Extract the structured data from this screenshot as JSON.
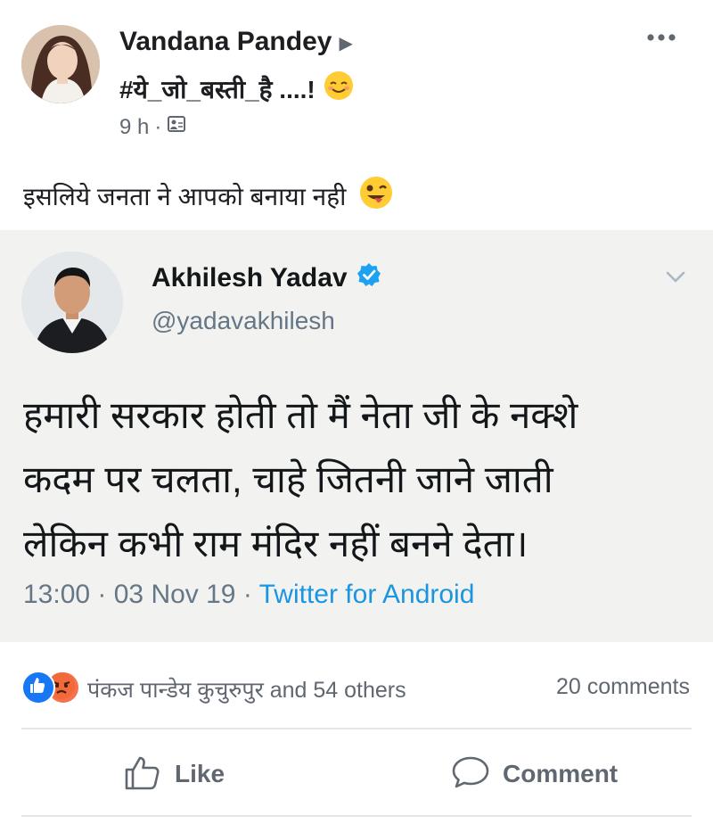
{
  "post": {
    "author": "Vandana Pandey",
    "hashtag_line": "#ये_जो_बस्ती_है ....!",
    "time": "9 h",
    "caption": "इसलिये जनता ने आपको बनाया नही",
    "icons": {
      "author_arrow": "play-arrow-icon",
      "hashtag_emoji": "smiling-emoji-icon",
      "audience": "audience-icon",
      "more": "more-dots-icon",
      "caption_emoji": "winking-tongue-emoji-icon"
    }
  },
  "shared_tweet": {
    "name": "Akhilesh Yadav",
    "handle": "@yadavakhilesh",
    "text_lines": [
      "हमारी सरकार होती तो मैं नेता जी के नक्शे",
      "कदम पर चलता, चाहे जितनी जाने जाती",
      "लेकिन कभी राम मंदिर नहीं बनने देता।"
    ],
    "time": "13:00 · 03 Nov 19 ·",
    "source": "Twitter for Android",
    "icons": {
      "verified": "verified-badge-icon",
      "chevron": "chevron-down-icon"
    }
  },
  "reactions": {
    "text": "पंकज पान्डेय कुचुरुपुर and 54 others",
    "comments": "20 comments",
    "icons": [
      "like-reaction-icon",
      "angry-reaction-icon"
    ]
  },
  "actions": {
    "like": "Like",
    "comment": "Comment"
  },
  "colors": {
    "tweet_card_bg": "#f2f3f0",
    "link": "#1b95e0",
    "like_blue": "#1877f2",
    "angry_orange": "#f7714c",
    "verified": "#1da1f2",
    "secondary_text": "#606770"
  }
}
